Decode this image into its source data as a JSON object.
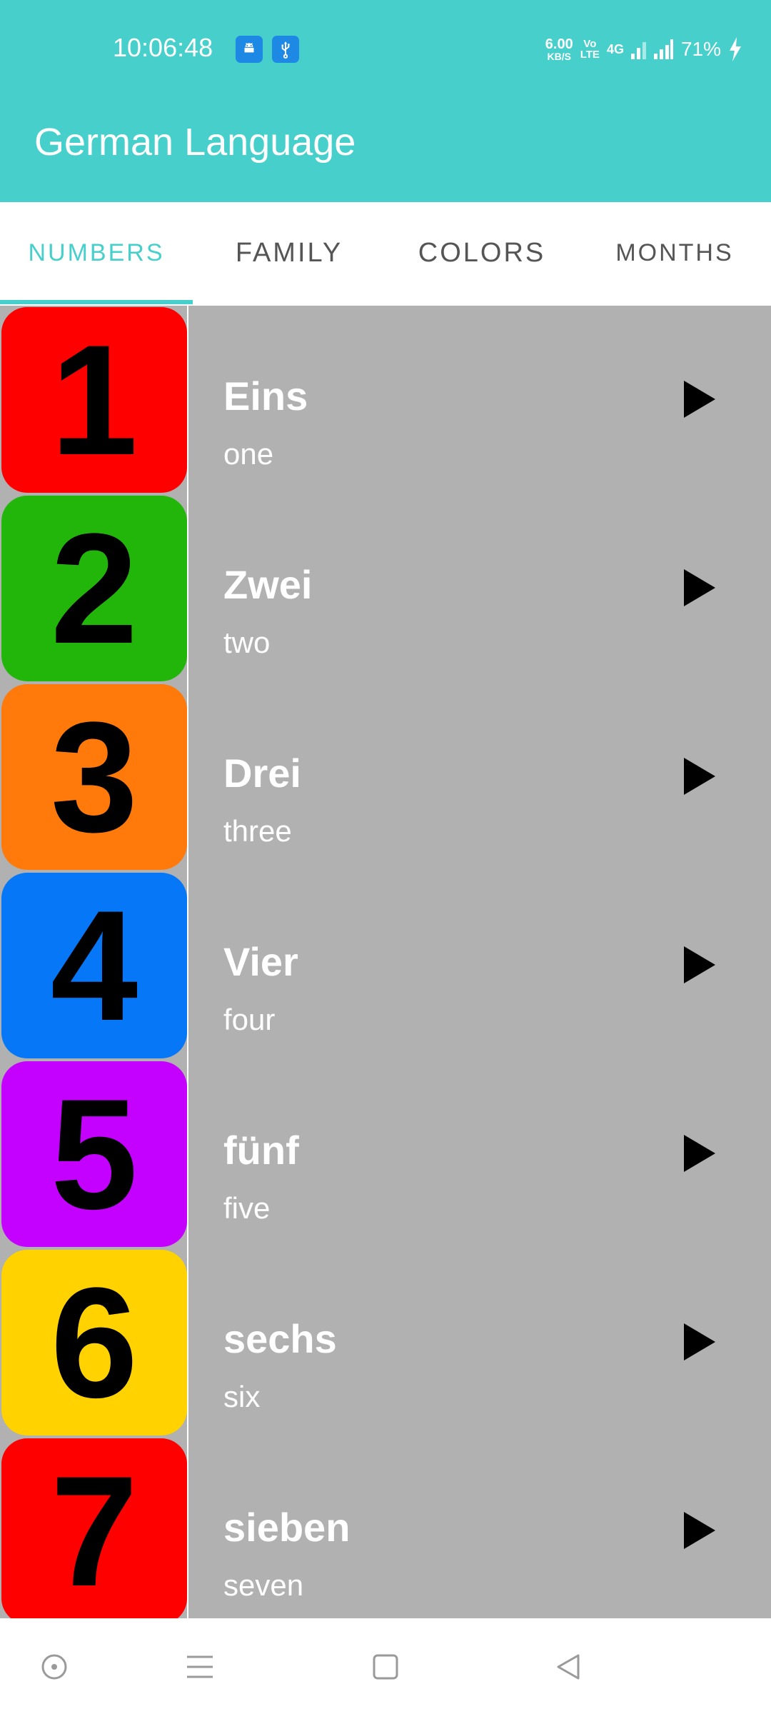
{
  "status_bar": {
    "time": "10:06:48",
    "net_speed_value": "6.00",
    "net_speed_unit": "KB/S",
    "volte_top": "Vo",
    "volte_bottom": "LTE",
    "network_type": "4G",
    "battery": "71%",
    "icons": [
      "android-debug-icon",
      "usb-icon",
      "signal-icon",
      "battery-charging-icon"
    ]
  },
  "app_bar": {
    "title": "German Language"
  },
  "tabs": [
    {
      "label": "NUMBERS",
      "active": true
    },
    {
      "label": "FAMILY",
      "active": false
    },
    {
      "label": "COLORS",
      "active": false
    },
    {
      "label": "MONTHS",
      "active": false
    }
  ],
  "colors": {
    "accent": "#47cfcb",
    "list_background": "#b0b1b0"
  },
  "items": [
    {
      "number": "1",
      "german": "Eins",
      "english": "one",
      "tile_color": "#ff0000"
    },
    {
      "number": "2",
      "german": "Zwei",
      "english": "two",
      "tile_color": "#22b60a"
    },
    {
      "number": "3",
      "german": "Drei",
      "english": "three",
      "tile_color": "#ff7a0a"
    },
    {
      "number": "4",
      "german": "Vier",
      "english": "four",
      "tile_color": "#0677f7"
    },
    {
      "number": "5",
      "german": "fünf",
      "english": "five",
      "tile_color": "#c400ff"
    },
    {
      "number": "6",
      "german": "sechs",
      "english": "six",
      "tile_color": "#ffd200"
    },
    {
      "number": "7",
      "german": "sieben",
      "english": "seven",
      "tile_color": "#ff0000"
    }
  ],
  "nav_bar": {
    "icons": [
      "assistant-icon",
      "menu-icon",
      "home-square-icon",
      "back-triangle-icon"
    ]
  }
}
